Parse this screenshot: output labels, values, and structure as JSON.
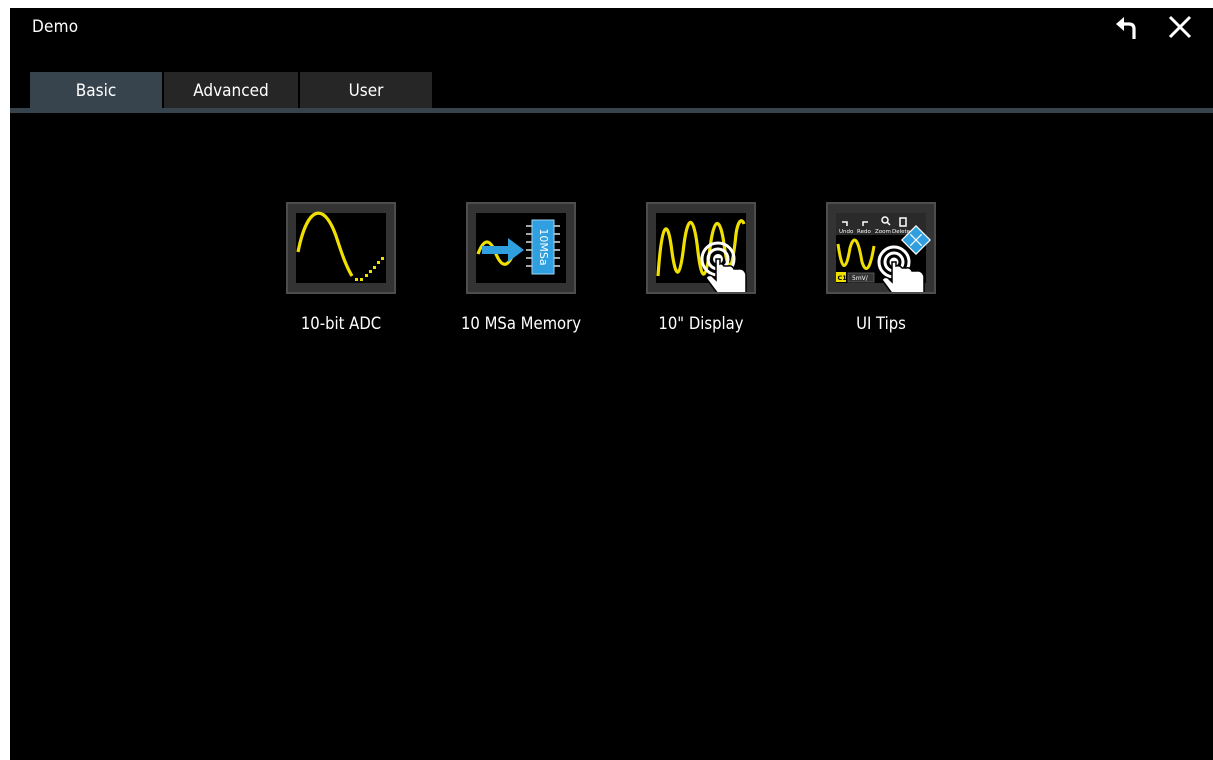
{
  "window": {
    "title": "Demo",
    "undo_icon": "undo-arrow-icon",
    "close_icon": "close-x-icon"
  },
  "tabs": [
    {
      "label": "Basic",
      "active": true
    },
    {
      "label": "Advanced",
      "active": false
    },
    {
      "label": "User",
      "active": false
    }
  ],
  "demos": [
    {
      "label": "10-bit ADC",
      "icon": "sine-wave-adc-icon"
    },
    {
      "label": "10 MSa Memory",
      "icon": "memory-chip-icon",
      "chip_text": "10MSa"
    },
    {
      "label": "10\" Display",
      "icon": "touch-display-icon"
    },
    {
      "label": "UI Tips",
      "icon": "ui-tips-icon",
      "toolbar": [
        "Undo",
        "Redo",
        "Zoom",
        "Delete"
      ],
      "channel": "C1",
      "scale": "5mV/"
    }
  ],
  "colors": {
    "background": "#000000",
    "tab_active": "#38444d",
    "tab_inactive": "#262626",
    "waveform": "#f0e000",
    "accent_blue": "#2f9fe0"
  }
}
